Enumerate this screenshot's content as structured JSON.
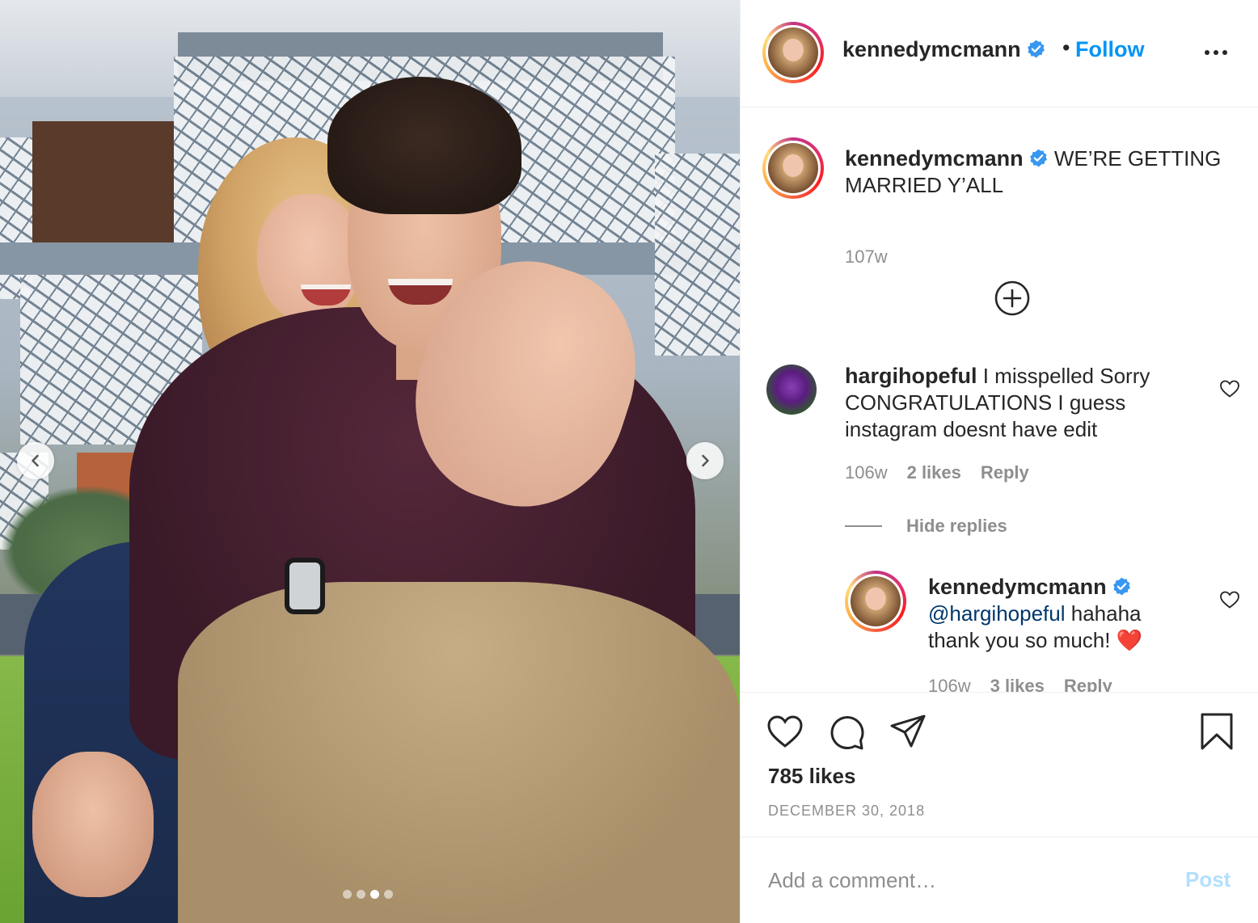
{
  "post": {
    "author": "kennedymcmann",
    "follow_label": "Follow",
    "separator": "•",
    "more_icon": "more-horizontal-icon",
    "verified_icon": "verified-badge-icon"
  },
  "carousel": {
    "prev_icon": "chevron-left-icon",
    "next_icon": "chevron-right-icon",
    "slide_count": 4,
    "active_slide": 3
  },
  "caption": {
    "username": "kennedymcmann",
    "text": "WE’RE GETTING MARRIED Y’ALL",
    "time": "107w"
  },
  "load_more_icon": "plus-circle-icon",
  "comments": [
    {
      "username": "hargihopeful",
      "text": "I misspelled Sorry CONGRATULATIONS I guess instagram doesnt have edit",
      "time": "106w",
      "likes": "2 likes",
      "reply_label": "Reply",
      "hide_replies_label": "Hide replies",
      "replies": [
        {
          "username": "kennedymcmann",
          "mention": "@hargihopeful",
          "text": "hahaha thank you so much!",
          "emoji": "❤️",
          "time": "106w",
          "likes": "3 likes",
          "reply_label": "Reply"
        }
      ]
    }
  ],
  "stats": {
    "likes": "785 likes",
    "date": "DECEMBER 30, 2018"
  },
  "composer": {
    "placeholder": "Add a comment…",
    "post_label": "Post"
  },
  "colors": {
    "accent": "#0095f6",
    "post_disabled": "#b2dffc",
    "muted": "#8e8e8e",
    "text": "#262626",
    "mention": "#00376b",
    "verified": "#3897f0"
  }
}
